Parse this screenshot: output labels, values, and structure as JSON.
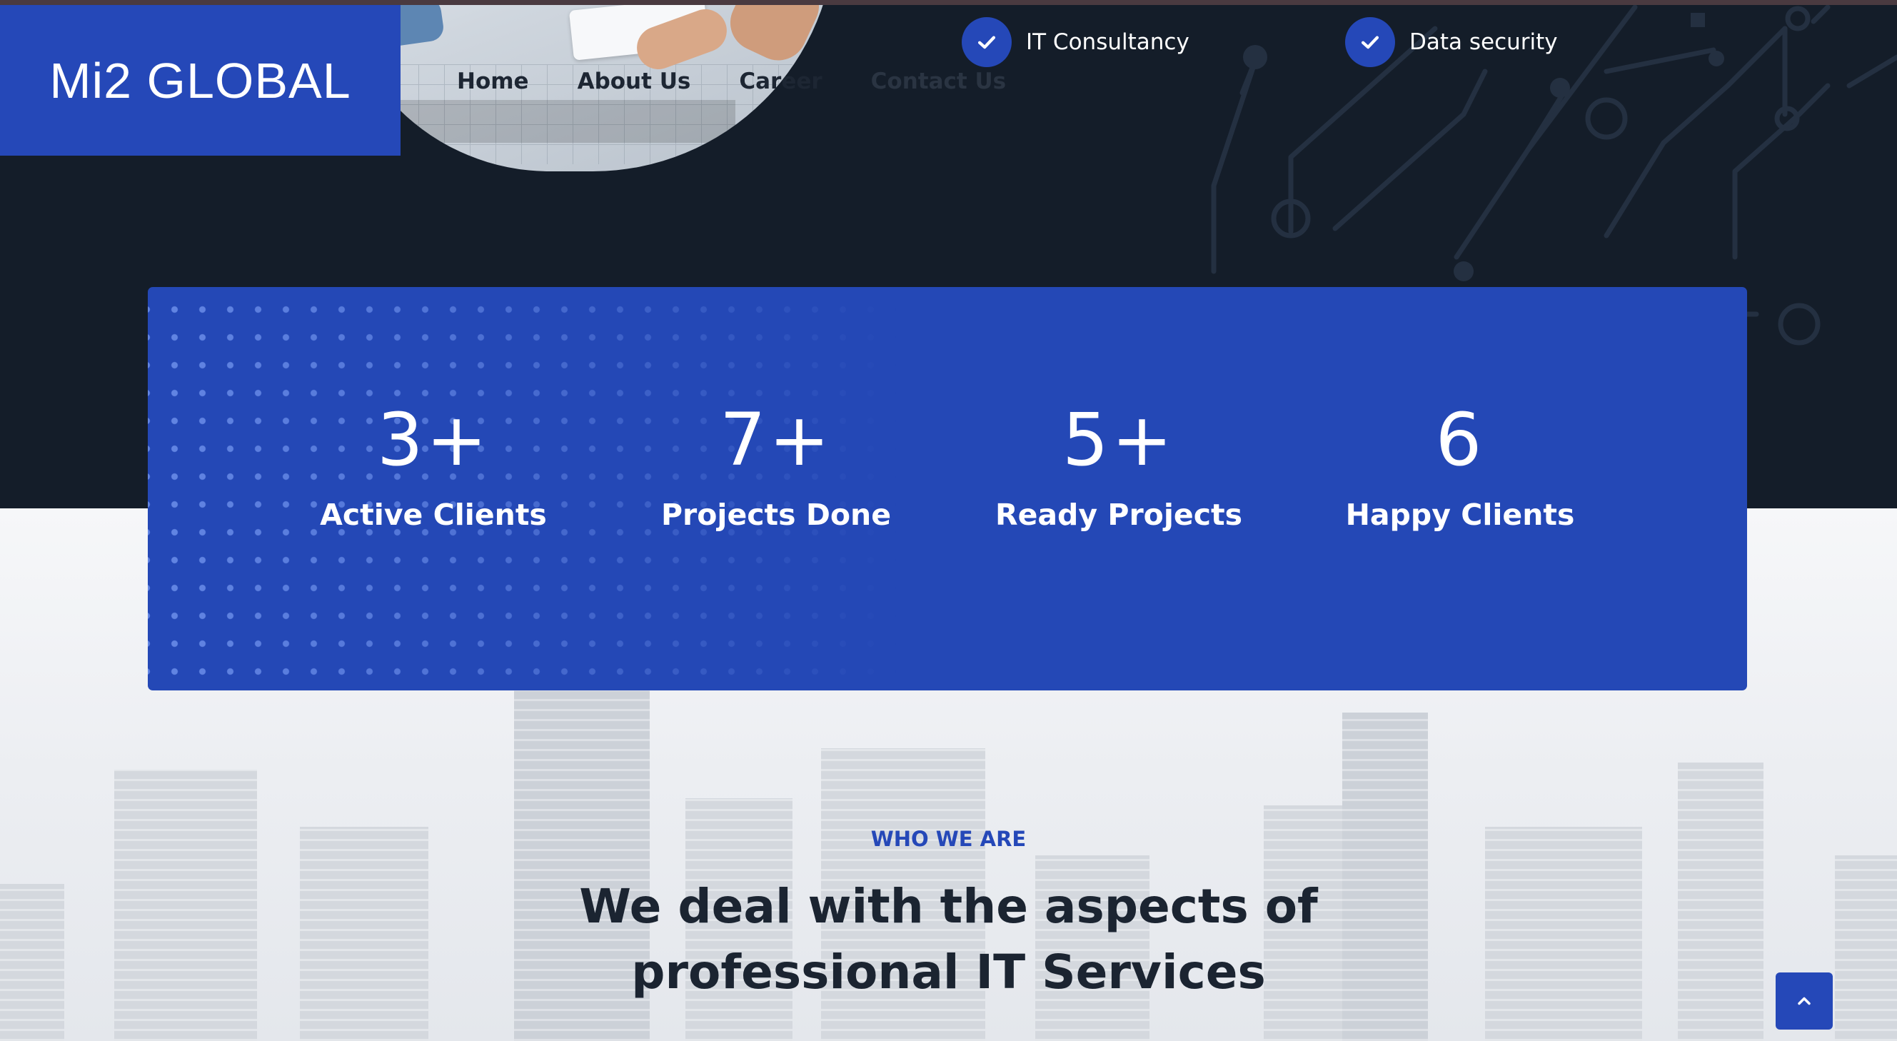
{
  "brand": {
    "logo_text": "Mi2 GLOBAL"
  },
  "nav": {
    "items": [
      "Home",
      "About Us",
      "Career",
      "Contact Us"
    ]
  },
  "features": [
    {
      "label": "IT Consultancy",
      "icon": "check-icon"
    },
    {
      "label": "Data security",
      "icon": "check-icon"
    }
  ],
  "stats": [
    {
      "value": "3+",
      "label": "Active Clients"
    },
    {
      "value": "7+",
      "label": "Projects Done"
    },
    {
      "value": "5+",
      "label": "Ready Projects"
    },
    {
      "value": "6",
      "label": "Happy Clients"
    }
  ],
  "about": {
    "eyebrow": "WHO WE ARE",
    "headline_line1": "We deal with the aspects of",
    "headline_line2": "professional IT Services"
  },
  "scroll_top": {
    "icon": "chevron-up-icon"
  },
  "colors": {
    "primary": "#2548b8",
    "hero_bg": "#141d29",
    "heading": "#1b2431"
  }
}
